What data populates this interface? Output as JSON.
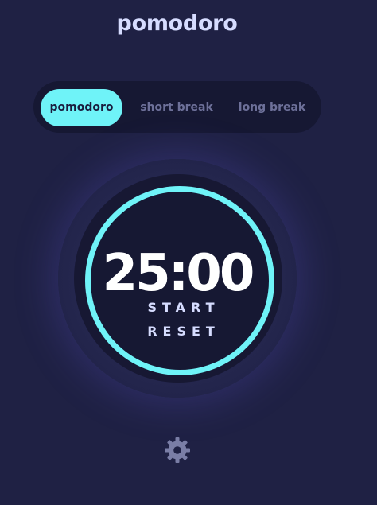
{
  "app": {
    "title": "pomodoro"
  },
  "tabs": [
    {
      "label": "pomodoro",
      "active": true
    },
    {
      "label": "short break",
      "active": false
    },
    {
      "label": "long break",
      "active": false
    }
  ],
  "timer": {
    "display": "25:00",
    "progress": 1.0
  },
  "controls": {
    "start_label": "START",
    "reset_label": "RESET"
  },
  "settings": {
    "icon": "gear-icon"
  },
  "colors": {
    "background": "#1f2144",
    "accent": "#6ff3f8",
    "text": "#d6dcff",
    "inactive_text": "#6d7099",
    "panel": "#161833"
  }
}
